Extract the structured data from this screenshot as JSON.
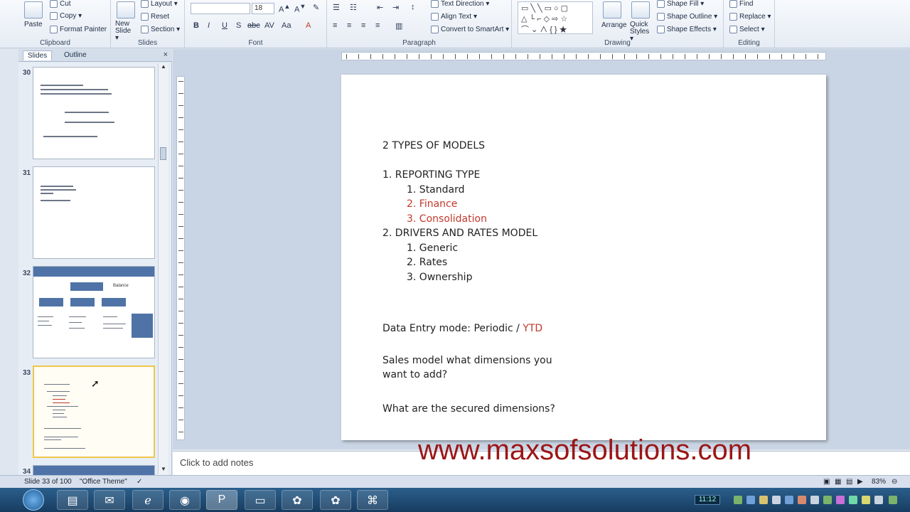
{
  "ribbon": {
    "clipboard": {
      "label": "Clipboard",
      "paste": "Paste",
      "cut": "Cut",
      "copy": "Copy ▾",
      "format_painter": "Format Painter"
    },
    "slides": {
      "label": "Slides",
      "new_slide": "New Slide ▾",
      "layout": "Layout ▾",
      "reset": "Reset",
      "section": "Section ▾"
    },
    "font": {
      "label": "Font",
      "font_size": "18"
    },
    "paragraph": {
      "label": "Paragraph",
      "text_direction": "Text Direction ▾",
      "align_text": "Align Text ▾",
      "convert_smartart": "Convert to SmartArt ▾"
    },
    "drawing": {
      "label": "Drawing",
      "arrange": "Arrange",
      "quick_styles": "Quick Styles ▾",
      "shape_fill": "Shape Fill ▾",
      "shape_outline": "Shape Outline ▾",
      "shape_effects": "Shape Effects ▾"
    },
    "editing": {
      "label": "Editing",
      "find": "Find",
      "replace": "Replace ▾",
      "select": "Select ▾"
    }
  },
  "left_pane": {
    "tabs": [
      "Slides",
      "Outline"
    ],
    "close": "×",
    "thumb_numbers": [
      "30",
      "31",
      "32",
      "33",
      "34"
    ],
    "thumb_32": {
      "label_b": "Balance"
    }
  },
  "slide": {
    "title": "2 TYPES OF MODELS",
    "item1": "1.   REPORTING TYPE",
    "item1_sub": [
      {
        "text": "1.   Standard",
        "color": "#222222"
      },
      {
        "text": "2.   Finance",
        "color": "#c0392b"
      },
      {
        "text": "3.   Consolidation",
        "color": "#c0392b"
      }
    ],
    "item2": "2.   DRIVERS AND RATES MODEL",
    "item2_sub": [
      "1.   Generic",
      "2.   Rates",
      "3.   Ownership"
    ],
    "data_entry_prefix": "Data Entry mode:  Periodic / ",
    "data_entry_ytd": "YTD",
    "sales_line1": "Sales model what dimensions you",
    "sales_line2": "want to add?",
    "secured": "What are the secured dimensions?"
  },
  "notes": {
    "placeholder": "Click to add notes"
  },
  "watermark": "www.maxsofsolutions.com",
  "status": {
    "slide_of": "Slide 33 of 100",
    "theme": "\"Office Theme\"",
    "zoom": "83%"
  },
  "taskbar": {
    "clock": "11:12"
  }
}
